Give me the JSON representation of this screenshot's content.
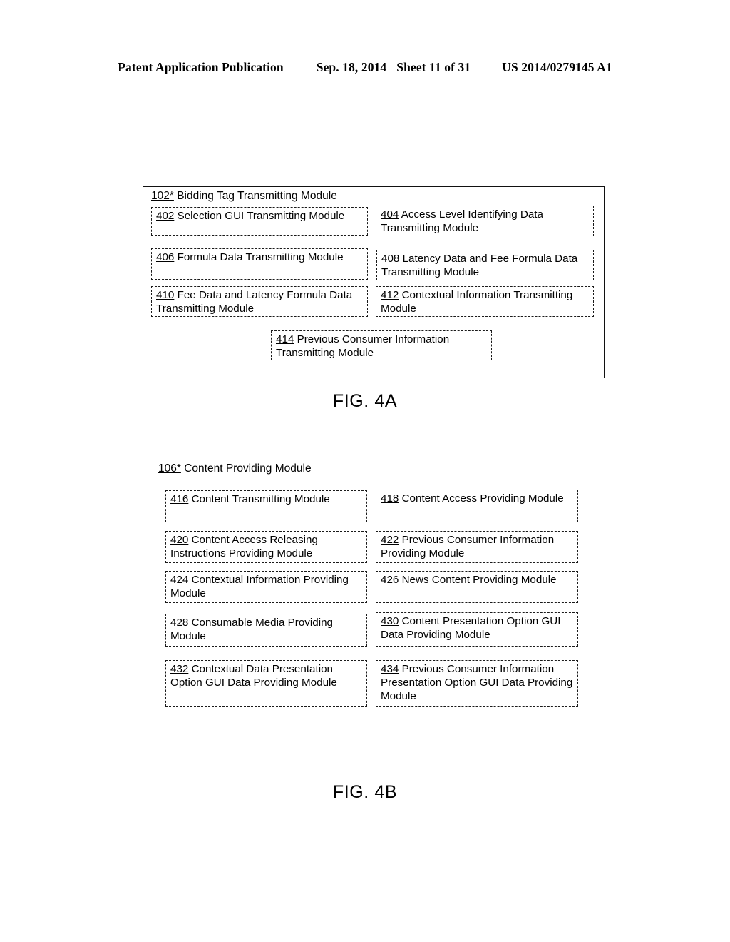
{
  "header": {
    "publication": "Patent Application Publication",
    "date": "Sep. 18, 2014",
    "sheet": "Sheet 11 of 31",
    "patent_number": "US 2014/0279145 A1"
  },
  "figures": [
    {
      "caption": "FIG. 4A",
      "container": {
        "ref": "102*",
        "label": "Bidding Tag Transmitting Module"
      },
      "modules": [
        {
          "ref": "402",
          "label": "Selection GUI Transmitting Module"
        },
        {
          "ref": "404",
          "label": "Access Level Identifying Data Transmitting Module"
        },
        {
          "ref": "406",
          "label": "Formula Data Transmitting Module"
        },
        {
          "ref": "408",
          "label": "Latency Data and Fee Formula Data Transmitting Module"
        },
        {
          "ref": "410",
          "label": "Fee Data and Latency Formula Data Transmitting Module"
        },
        {
          "ref": "412",
          "label": "Contextual Information Transmitting Module"
        },
        {
          "ref": "414",
          "label": "Previous Consumer Information Transmitting Module"
        }
      ]
    },
    {
      "caption": "FIG. 4B",
      "container": {
        "ref": "106*",
        "label": "Content Providing Module"
      },
      "modules": [
        {
          "ref": "416",
          "label": "Content Transmitting Module"
        },
        {
          "ref": "418",
          "label": "Content Access Providing Module"
        },
        {
          "ref": "420",
          "label": "Content Access Releasing Instructions Providing Module"
        },
        {
          "ref": "422",
          "label": "Previous Consumer Information Providing Module"
        },
        {
          "ref": "424",
          "label": "Contextual Information Providing Module"
        },
        {
          "ref": "426",
          "label": "News Content Providing Module"
        },
        {
          "ref": "428",
          "label": "Consumable Media Providing Module"
        },
        {
          "ref": "430",
          "label": "Content Presentation Option GUI Data Providing Module"
        },
        {
          "ref": "432",
          "label": "Contextual Data Presentation Option GUI Data Providing Module"
        },
        {
          "ref": "434",
          "label": "Previous Consumer Information Presentation Option GUI Data Providing Module"
        }
      ]
    }
  ]
}
